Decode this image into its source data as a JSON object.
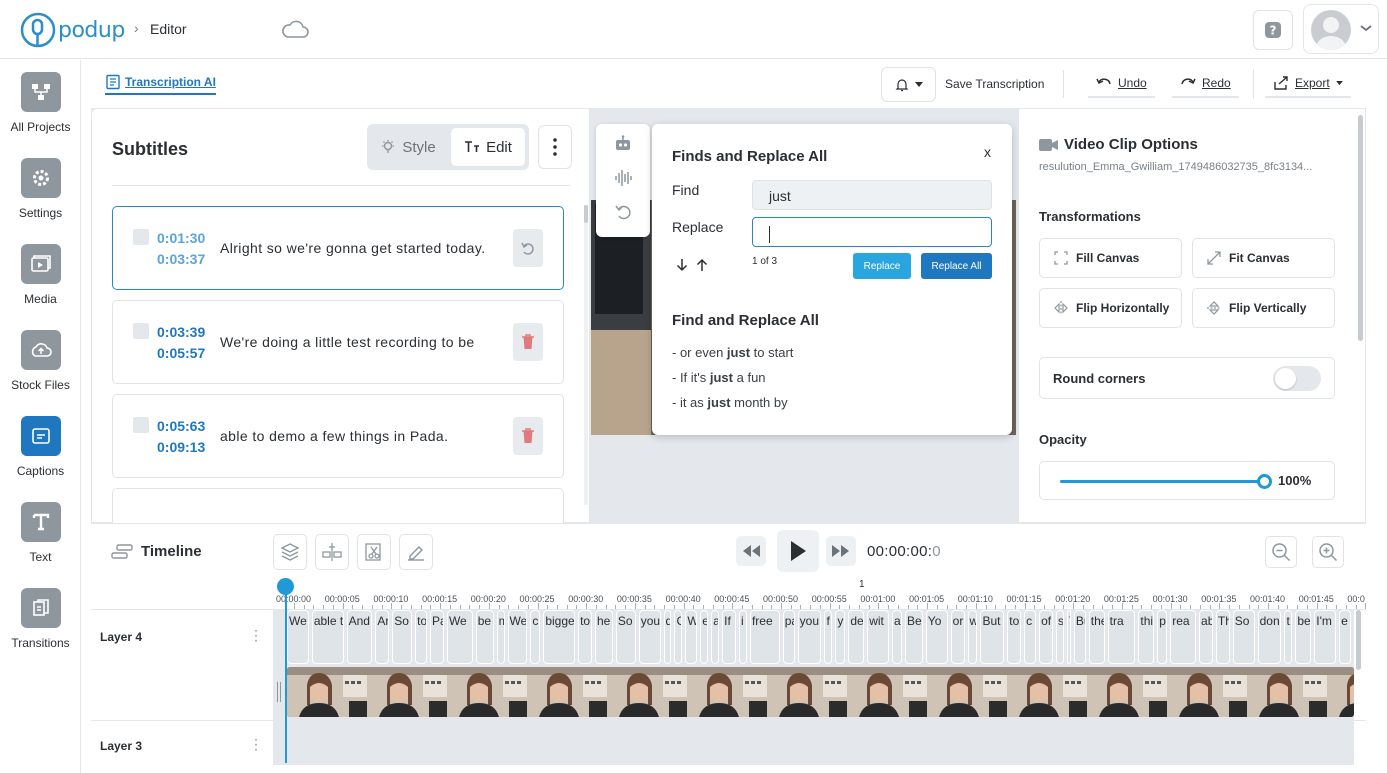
{
  "header": {
    "logo_text": "podup",
    "breadcrumb": "Editor",
    "breadcrumb_sep": "›"
  },
  "sidebar": {
    "items": [
      {
        "label": "All Projects",
        "icon": "projects-icon"
      },
      {
        "label": "Settings",
        "icon": "gear-icon"
      },
      {
        "label": "Media",
        "icon": "media-icon"
      },
      {
        "label": "Stock Files",
        "icon": "cloud-icon"
      },
      {
        "label": "Captions",
        "icon": "captions-icon",
        "active": true
      },
      {
        "label": "Text",
        "icon": "text-icon"
      },
      {
        "label": "Transitions",
        "icon": "transitions-icon"
      }
    ]
  },
  "toolbar": {
    "tab_label": "Transcription AI",
    "save_label": "Save Transcription",
    "undo_label": "Undo",
    "redo_label": "Redo",
    "export_label": "Export"
  },
  "subtitles": {
    "title": "Subtitles",
    "style_label": "Style",
    "edit_label": "Edit",
    "captions": [
      {
        "start": "0:01:30",
        "end": "0:03:37",
        "text": "Alright so we're gonna get started today."
      },
      {
        "start": "0:03:39",
        "end": "0:05:57",
        "text": "We're doing a little test recording to be"
      },
      {
        "start": "0:05:63",
        "end": "0:09:13",
        "text": "able to demo a few things in Pada."
      }
    ]
  },
  "find_replace": {
    "title": "Finds and Replace All",
    "close": "x",
    "find_label": "Find",
    "find_value": "just",
    "replace_label": "Replace",
    "replace_value": "",
    "count": "1 of 3",
    "replace_btn": "Replace",
    "replace_all_btn": "Replace All",
    "results_title": "Find and Replace All",
    "results": [
      {
        "before": "- or even ",
        "match": "just",
        "after": " to start"
      },
      {
        "before": "- If it's ",
        "match": "just",
        "after": " a fun"
      },
      {
        "before": "- it as ",
        "match": "just",
        "after": " month by"
      }
    ]
  },
  "clip_options": {
    "title": "Video Clip Options",
    "filename": "resulution_Emma_Gwilliam_1749486032735_8fc3134...",
    "transformations_label": "Transformations",
    "fill_canvas": "Fill Canvas",
    "fit_canvas": "Fit Canvas",
    "flip_h": "Flip Horizontally",
    "flip_v": "Flip Vertically",
    "round_corners_label": "Round corners",
    "round_corners_on": false,
    "opacity_label": "Opacity",
    "opacity_value": "100%",
    "opacity_fraction": 1.0
  },
  "timeline": {
    "title": "Timeline",
    "time": "00:00:00:",
    "time_frame": "0",
    "marker": "1",
    "ticks": [
      "00:00:00",
      "00:00:05",
      "00:00:10",
      "00:00:15",
      "00:00:20",
      "00:00:25",
      "00:00:30",
      "00:00:35",
      "00:00:40",
      "00:00:45",
      "00:00:50",
      "00:00:55",
      "00:01:00",
      "00:01:05",
      "00:01:10",
      "00:01:15",
      "00:01:20",
      "00:01:25",
      "00:01:30",
      "00:01:35",
      "00:01:40",
      "00:01:45",
      "00:0"
    ],
    "layers": [
      {
        "label": "Layer 4"
      },
      {
        "label": "Layer 3"
      }
    ],
    "clip_words": [
      "We",
      "able t",
      "And",
      "Ar",
      "So",
      "to",
      "Pa",
      "We",
      "be",
      "m",
      "We",
      "c",
      "bigge",
      "to",
      "he",
      "So",
      "you",
      "d",
      "C",
      "W",
      "e",
      "a",
      "If",
      "i",
      "free",
      "pa",
      "you",
      "f",
      "y",
      "de",
      "wit",
      "a",
      "Be",
      "Yo",
      "or",
      "w",
      "But",
      "to",
      "c",
      "of",
      "s",
      "T",
      "Bu",
      "the",
      "tra",
      "thi",
      "p",
      "rea",
      "ab",
      "Th",
      "So",
      "don",
      "t",
      "be",
      "I'm",
      "e"
    ]
  },
  "colors": {
    "accent": "#1f77c0",
    "accent_light": "#1f9ad6",
    "delete_icon": "#e07a80"
  }
}
